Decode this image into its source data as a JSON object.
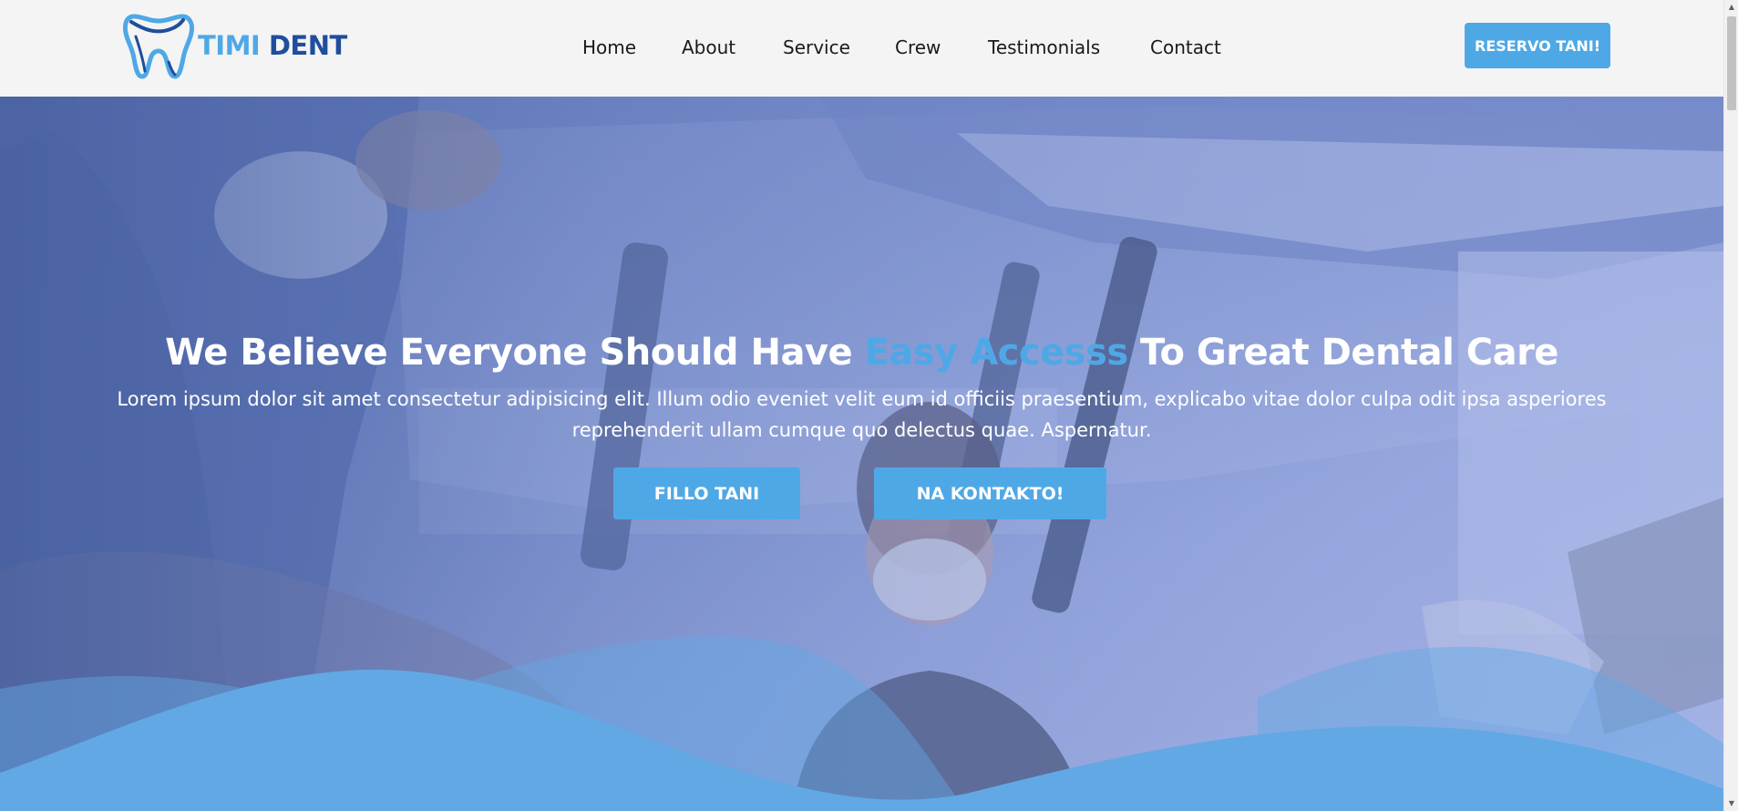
{
  "header": {
    "logo": {
      "icon": "tooth-icon",
      "text_part1": "TIMI",
      "text_part2": "DENT"
    },
    "nav": [
      {
        "label": "Home"
      },
      {
        "label": "About"
      },
      {
        "label": "Service"
      },
      {
        "label": "Crew"
      },
      {
        "label": "Testimonials"
      },
      {
        "label": "Contact"
      }
    ],
    "reserve_button": "RESERVO TANI!"
  },
  "hero": {
    "title_before": "We Believe Everyone Should Have ",
    "title_accent": "Easy Accesss",
    "title_after": " To Great Dental Care",
    "subtitle": "Lorem ipsum dolor sit amet consectetur adipisicing elit. Illum odio eveniet velit eum id officiis praesentium, explicabo vitae dolor culpa odit ipsa asperiores reprehenderit ullam cumque quo delectus quae. Aspernatur.",
    "primary_button": "FILLO TANI",
    "secondary_button": "NA KONTAKTO!"
  },
  "colors": {
    "accent": "#4fa8e6",
    "brand_dark": "#1f4e9c",
    "header_bg": "#f4f4f4",
    "wave": "#62a8e4"
  },
  "scrollbar": {
    "up_icon": "scroll-up-arrow-icon",
    "down_icon": "scroll-down-arrow-icon"
  }
}
